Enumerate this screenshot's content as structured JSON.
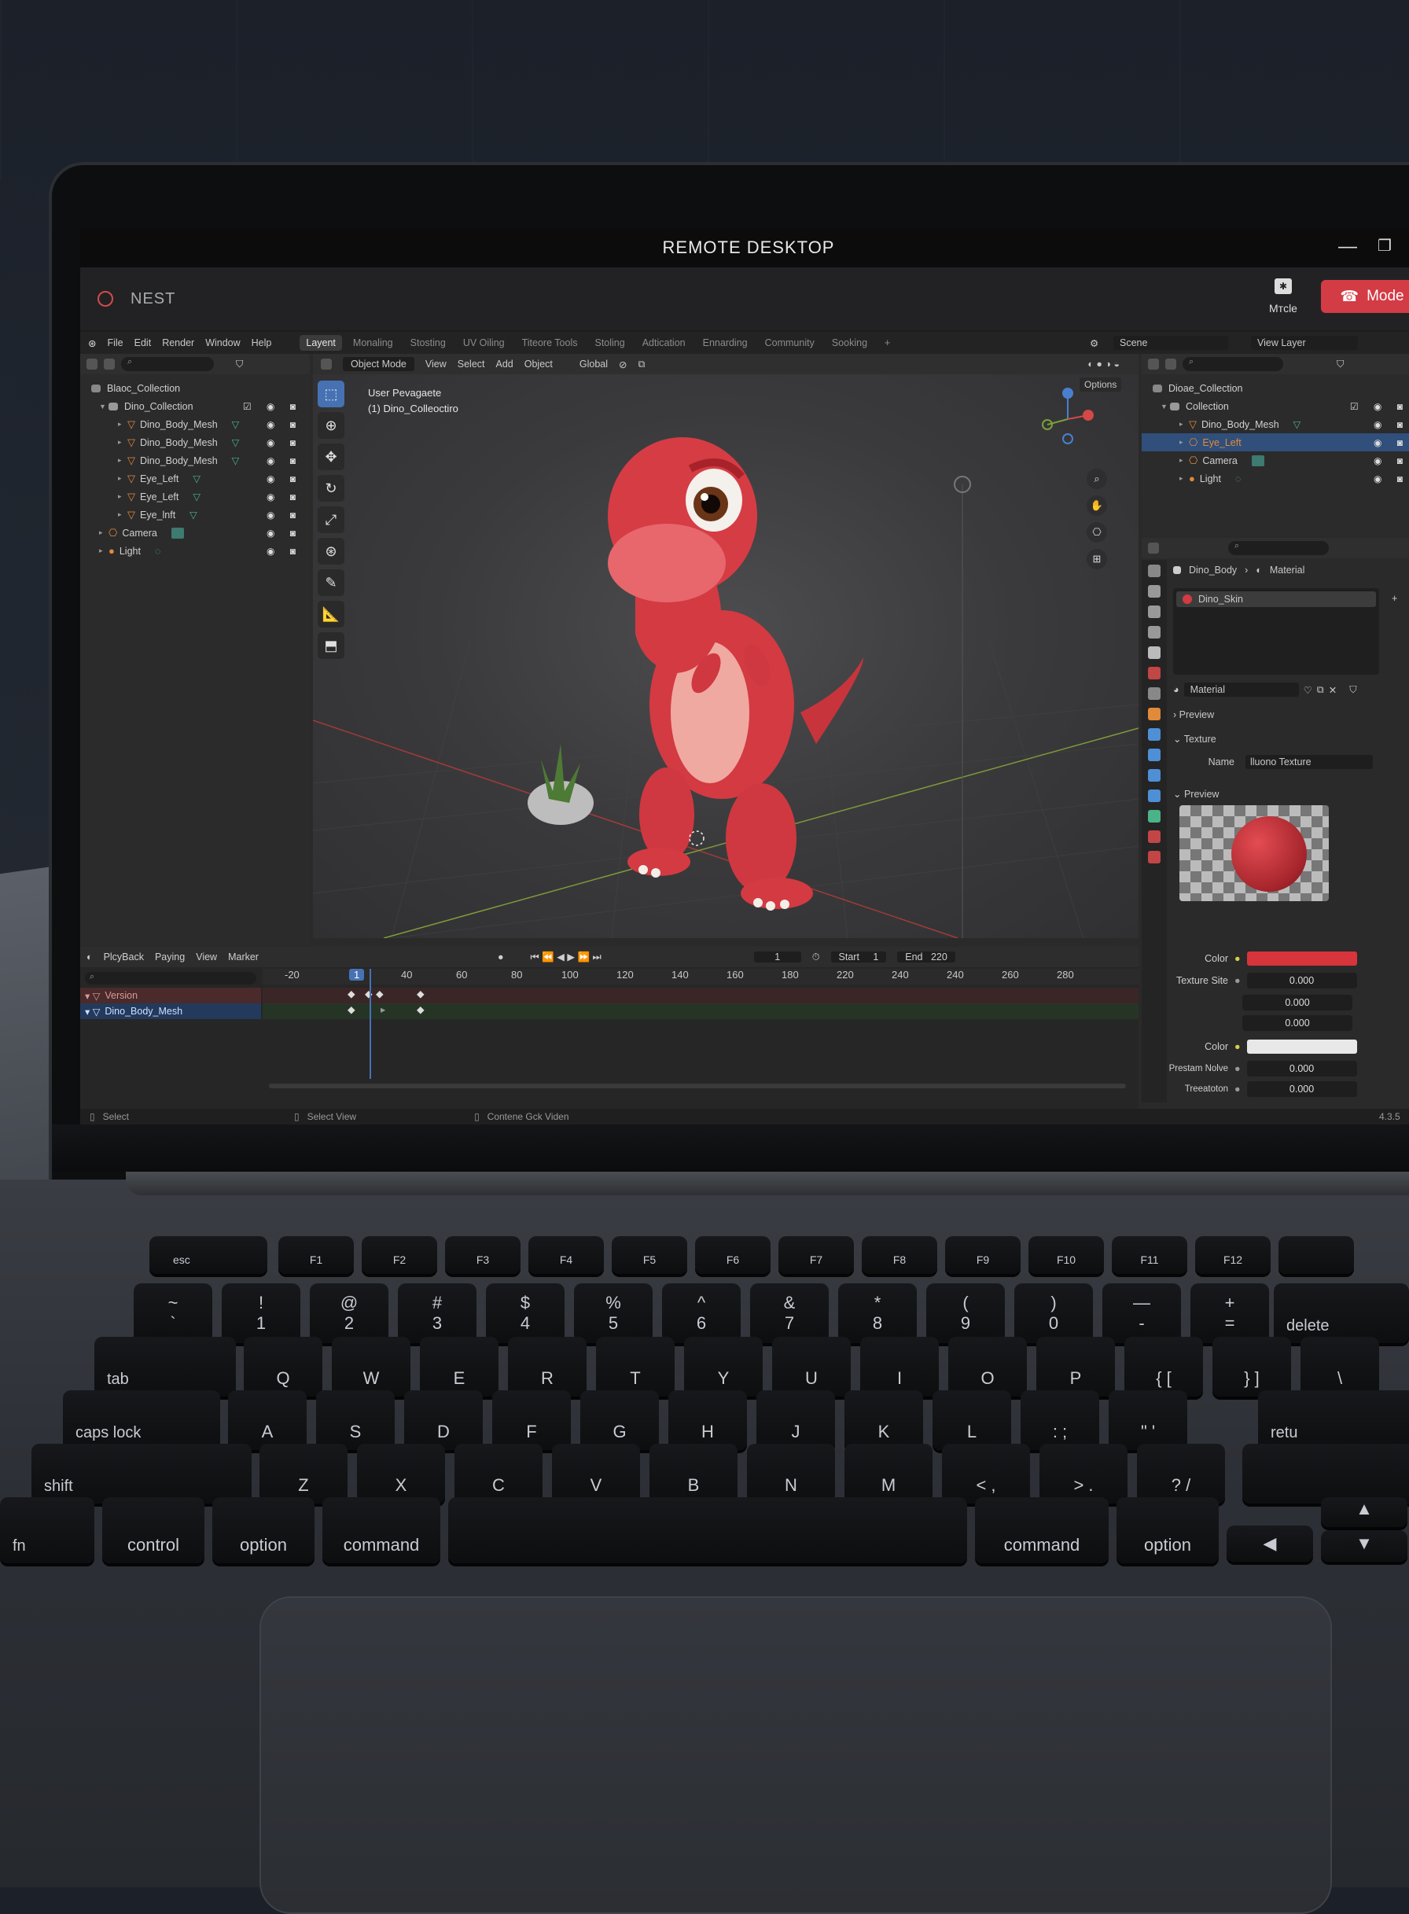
{
  "remote_desktop": {
    "title": "REMOTE DESKTOP",
    "minimize_glyph": "—",
    "maximize_glyph": "❐",
    "session_name": "NEST",
    "mute_label": "Mтcle",
    "mode_label": "Mode"
  },
  "blender": {
    "menu": [
      "File",
      "Edit",
      "Render",
      "Window",
      "Help"
    ],
    "workspaces": [
      "Layent",
      "Monaling",
      "Stosting",
      "UV Oiling",
      "Titeore Tools",
      "Stoling",
      "Adtication",
      "Ennarding",
      "Community",
      "Sooking"
    ],
    "active_workspace": "Layent",
    "scene": "Scene",
    "view_layer": "View Layer",
    "outliner_left": {
      "root": "Blaoc_Collection",
      "collection": "Dino_Collection",
      "items": [
        "Dino_Body_Mesh",
        "Dino_Body_Mesh",
        "Dino_Body_Mesh",
        "Eye_Left",
        "Eye_Left",
        "Eye_lnft"
      ],
      "camera": "Camera",
      "light": "Light"
    },
    "viewport": {
      "mode": "Object Mode",
      "menus": [
        "View",
        "Select",
        "Add",
        "Object"
      ],
      "transform": "Global",
      "options": "Options",
      "info_line1": "User Pevagaete",
      "info_line2": "(1) Dino_Colleoctiro"
    },
    "outliner_right": {
      "root": "Dioae_Collection",
      "collection": "Collection",
      "items": [
        "Dino_Body_Mesh",
        "Eye_Left",
        "Camera",
        "Light"
      ],
      "selected": "Eye_Left"
    },
    "properties": {
      "breadcrumb_object": "Dino_Body",
      "breadcrumb_tab": "Material",
      "material_slot": "Dino_Skin",
      "material_field": "Material",
      "preview_section": "Preview",
      "texture_section": "Texture",
      "name_label": "Name",
      "name_value": "lluono Texture",
      "preview2_section": "Preview",
      "color_label": "Color",
      "color_value": "#d8343c",
      "texture_site_label": "Texture Site",
      "texture_site_values": [
        "0.000",
        "0.000",
        "0.000"
      ],
      "color2_label": "Color",
      "color2_value": "#e8e8e8",
      "prestam_label": "Prestam Nolve",
      "prestam_value": "0.000",
      "treeaton_label": "Treeatoton",
      "treeaton_value": "0.000",
      "version": "4.3.5"
    },
    "timeline": {
      "menus": [
        "PlcyBack",
        "Paying",
        "View",
        "Marker"
      ],
      "current_frame": "1",
      "start_label": "Start",
      "start_value": "1",
      "end_label": "End",
      "end_value": "220",
      "ruler": [
        "-20",
        "1",
        "40",
        "60",
        "80",
        "100",
        "120",
        "140",
        "160",
        "180",
        "220",
        "240",
        "240",
        "260",
        "280"
      ],
      "tracks": [
        "Version",
        "Dino_Body_Mesh"
      ]
    },
    "status_bar": [
      "Select",
      "Select View",
      "Contene Gck Viden"
    ]
  },
  "keyboard": {
    "function_row": [
      "esc",
      "F1",
      "F2",
      "F3",
      "F4",
      "F5",
      "F6",
      "F7",
      "F8",
      "F9",
      "F10",
      "F11",
      "F12"
    ],
    "number_row": [
      [
        "~",
        "`"
      ],
      [
        "!",
        "1"
      ],
      [
        "@",
        "2"
      ],
      [
        "#",
        "3"
      ],
      [
        "$",
        "4"
      ],
      [
        "%",
        "5"
      ],
      [
        "^",
        "6"
      ],
      [
        "&",
        "7"
      ],
      [
        "*",
        "8"
      ],
      [
        "(",
        "9"
      ],
      [
        ")",
        "0"
      ],
      [
        "—",
        "-"
      ],
      [
        "+",
        "="
      ]
    ],
    "delete": "delete",
    "tab": "tab",
    "qwerty_row": [
      "Q",
      "W",
      "E",
      "R",
      "T",
      "Y",
      "U",
      "I",
      "O",
      "P",
      "{ [",
      "} ]",
      "\\"
    ],
    "caps": "caps lock",
    "home_row": [
      "A",
      "S",
      "D",
      "F",
      "G",
      "H",
      "J",
      "K",
      "L",
      ": ;",
      "\" '"
    ],
    "return": "retu",
    "shift": "shift",
    "bottom_letters": [
      "Z",
      "X",
      "C",
      "V",
      "B",
      "N",
      "M",
      "< ,",
      "> .",
      "? /"
    ],
    "fn": "fn",
    "control": "control",
    "option": "option",
    "command": "command",
    "command_right": "command",
    "option_right": "option"
  }
}
